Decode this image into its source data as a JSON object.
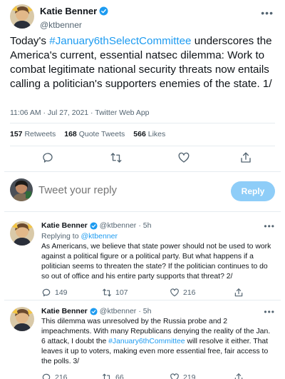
{
  "main_tweet": {
    "author_name": "Katie Benner",
    "author_handle": "@ktbenner",
    "text_prefix": "Today's ",
    "hashtag": "#January6thSelectCommittee",
    "text_suffix": " underscores the America's current, essential natsec dilemma: Work to combat legitimate national security threats now entails calling a politician's supporters enemies of the state. 1/",
    "meta": "11:06 AM · Jul 27, 2021 · Twitter Web App",
    "retweets_count": "157",
    "retweets_label": "Retweets",
    "quote_count": "168",
    "quote_label": "Quote Tweets",
    "likes_count": "566",
    "likes_label": "Likes"
  },
  "composer": {
    "placeholder": "Tweet your reply",
    "reply_button": "Reply"
  },
  "replies": [
    {
      "author_name": "Katie Benner",
      "author_handle": "@ktbenner",
      "time": "· 5h",
      "replying_prefix": "Replying to ",
      "replying_handle": "@ktbenner",
      "text": "As Americans, we believe that state power should not be used to work against a political figure or a political party. But what happens if a politician seems to threaten the state? If the politician continues to do so out of office and his entire party supports that threat? 2/",
      "replies": "149",
      "retweets": "107",
      "likes": "216"
    },
    {
      "author_name": "Katie Benner",
      "author_handle": "@ktbenner",
      "time": "· 5h",
      "text_prefix": "This dilemma was unresolved by the Russia probe and 2 impeachments. With many Republicans denying the reality of the Jan. 6 attack, I doubt the ",
      "hashtag": "#January6thCommittee",
      "text_suffix": " will resolve it either. That leaves it up to voters, making even more essential free, fair access to the polls. 3/",
      "replies": "216",
      "retweets": "66",
      "likes": "219"
    }
  ],
  "more_icon": "•••",
  "colors": {
    "accent": "#1d9bf0",
    "reply_button_bg": "#8ecdf8",
    "muted_text": "#536471"
  }
}
